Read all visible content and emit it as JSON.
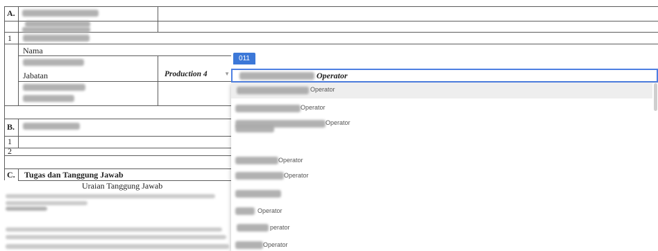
{
  "sections": {
    "a": {
      "marker": "A.",
      "row_num": "1",
      "nama_label": "Nama",
      "jabatan_label": "Jabatan",
      "jabatan_dropdown_value": "Production 4"
    },
    "b": {
      "marker": "B.",
      "rows": [
        "1",
        "2"
      ]
    },
    "c": {
      "marker": "C.",
      "title": "Tugas dan Tanggung Jawab",
      "col_header": "Uraian Tanggung Jawab"
    }
  },
  "editor": {
    "tag": "011",
    "value": "Operator"
  },
  "options": [
    "Operator",
    "Operator",
    "",
    "Operator",
    "Operator",
    "Operator",
    "",
    "Operator",
    "perator",
    "Operator"
  ]
}
